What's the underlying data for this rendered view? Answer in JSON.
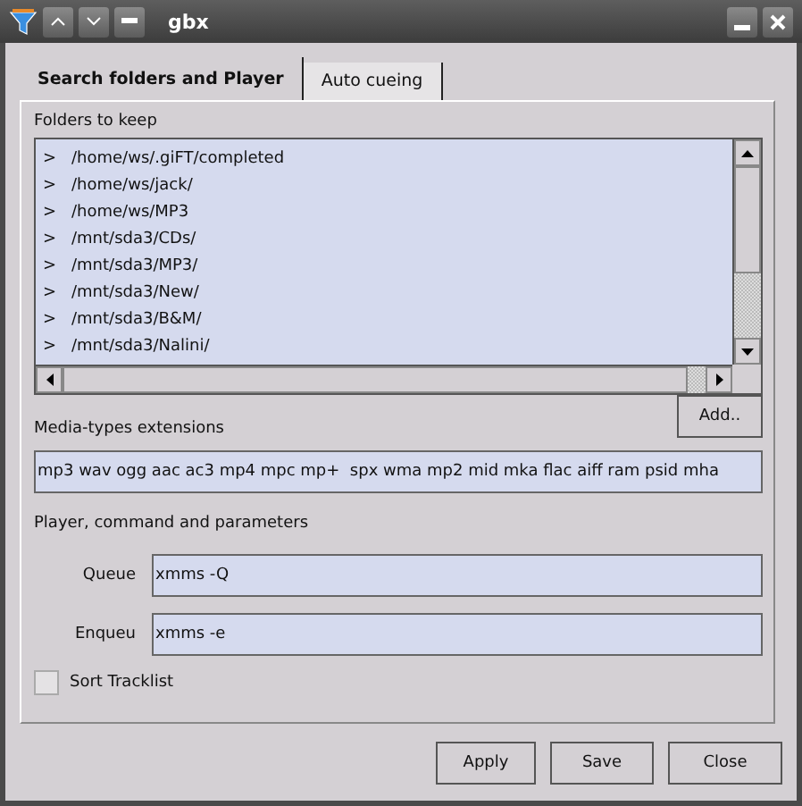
{
  "window": {
    "title": "gbx"
  },
  "tabs": [
    {
      "label": "Search folders and Player",
      "selected": true
    },
    {
      "label": "Auto cueing",
      "selected": false
    }
  ],
  "folders": {
    "label": "Folders to keep",
    "items": [
      {
        "marker": ">",
        "path": "/home/ws/.giFT/completed"
      },
      {
        "marker": ">",
        "path": "/home/ws/jack/"
      },
      {
        "marker": ">",
        "path": "/home/ws/MP3"
      },
      {
        "marker": ">",
        "path": "/mnt/sda3/CDs/"
      },
      {
        "marker": ">",
        "path": "/mnt/sda3/MP3/"
      },
      {
        "marker": ">",
        "path": "/mnt/sda3/New/"
      },
      {
        "marker": ">",
        "path": "/mnt/sda3/B&M/"
      },
      {
        "marker": ">",
        "path": "/mnt/sda3/Nalini/"
      }
    ],
    "add_button": "Add.."
  },
  "media_types": {
    "label": "Media-types extensions",
    "value": "mp3 wav ogg aac ac3 mp4 mpc mp+  spx wma mp2 mid mka flac aiff ram psid mha"
  },
  "player": {
    "label": "Player, command and parameters",
    "fields": [
      {
        "label": "Queue",
        "value": "xmms -Q"
      },
      {
        "label": "Enqueu",
        "value": "xmms -e"
      }
    ]
  },
  "sort_tracklist": {
    "label": "Sort Tracklist",
    "checked": false
  },
  "buttons": [
    "Apply",
    "Save",
    "Close"
  ]
}
